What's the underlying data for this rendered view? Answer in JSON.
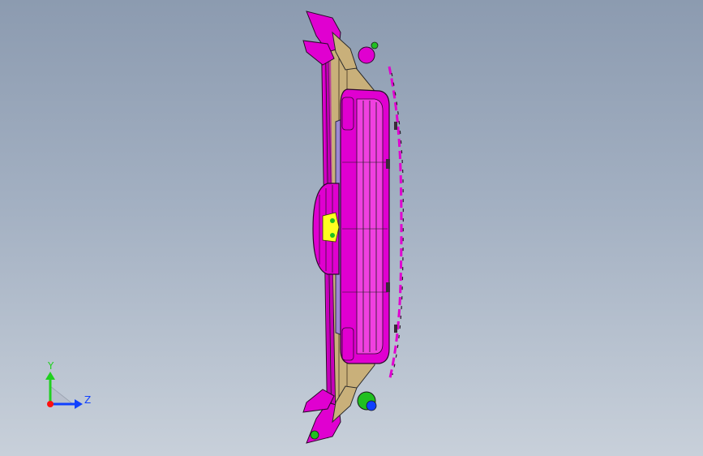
{
  "viewport": {
    "background_top": "#8c9bb0",
    "background_bottom": "#c8d0da"
  },
  "model": {
    "colors": {
      "primary": "#e000d0",
      "secondary": "#c9b07a",
      "accent_yellow": "#ffff20",
      "accent_green": "#20c020",
      "edges": "#1a1a1a"
    }
  },
  "triad": {
    "y_label": "Y",
    "z_label": "Z",
    "colors": {
      "y_axis": "#20d020",
      "z_axis": "#1040ff",
      "x_dot": "#ff1010"
    }
  }
}
